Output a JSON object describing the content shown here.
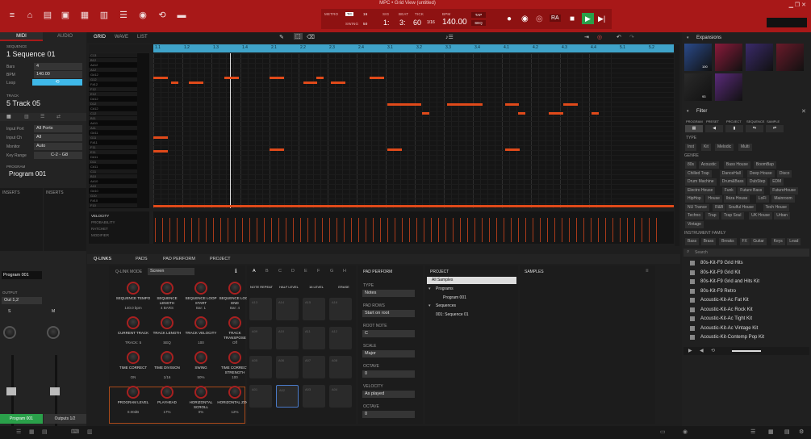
{
  "window": {
    "title": "MPC • Grid View (untitled)"
  },
  "transport": {
    "metro_label": "METRO",
    "tc_label": "TC",
    "tc_value": "16",
    "swing_label": "SWING",
    "swing_value": "50",
    "sig_label": "SIG",
    "beat_label": "BEAT",
    "tick_label": "TICK",
    "bar": "1:",
    "beat": "3:",
    "tick": "60",
    "note_value": "1/16",
    "bpm_label": "BPM",
    "bpm": "140.00",
    "tap": "TAP",
    "seq": "SEQ"
  },
  "left": {
    "tabs": [
      "MIDI",
      "AUDIO"
    ],
    "sequence_label": "SEQUENCE",
    "sequence_name": "1 Sequence 01",
    "bars_label": "Bars",
    "bars_value": "4",
    "bpm_label": "BPM",
    "bpm_value": "140.00",
    "loop_label": "Loop",
    "track_label": "TRACK",
    "track_name": "5 Track 05",
    "input_port_label": "Input Port",
    "input_port": "All Ports",
    "input_ch_label": "Input Ch",
    "input_ch": "All",
    "monitor_label": "Monitor",
    "monitor": "Auto",
    "key_range_label": "Key Range",
    "key_range": "C-2 - G8",
    "program_label": "PROGRAM",
    "program_name": "Program 001",
    "inserts_label": "INSERTS",
    "inserts_label2": "INSERTS",
    "program_field": "Program 001",
    "output_label": "OUTPUT",
    "output": "Out 1,2",
    "s_btn": "S",
    "m_btn": "M",
    "bottom_tab_1": "Program 001",
    "bottom_tab_2": "Outputs 1/2"
  },
  "grid": {
    "tabs": [
      "GRID",
      "WAVE",
      "LIST"
    ],
    "ruler": [
      "1.1",
      "1.2",
      "1.3",
      "1.4",
      "2.1",
      "2.2",
      "2.3",
      "2.4",
      "3.1",
      "3.2",
      "3.3",
      "3.4",
      "4.1",
      "4.2",
      "4.3",
      "4.4",
      "5.1",
      "5.2"
    ],
    "keys": [
      "C13",
      "B12",
      "A#12",
      "A12",
      "G#12",
      "G12",
      "F#12",
      "F12",
      "E12",
      "D#12",
      "D12",
      "C#12",
      "C12",
      "B11",
      "A#11",
      "A11",
      "G#11",
      "G11",
      "F#11",
      "F11",
      "E11",
      "D#11",
      "D11",
      "C#11",
      "C11",
      "B10",
      "A#10",
      "A10",
      "G#10",
      "G10",
      "F#10",
      "F10"
    ],
    "lanes": [
      "VELOCITY",
      "PROBABILITY",
      "RATCHET",
      "MODIFIER"
    ]
  },
  "qlinks": {
    "tabs": [
      "Q-LINKS",
      "PADS",
      "PAD PERFORM",
      "PROJECT"
    ],
    "mode_label": "Q-LINK MODE",
    "mode": "Screen",
    "knobs": [
      {
        "label": "SEQUENCE TEMPO",
        "value": "140.0 bpm"
      },
      {
        "label": "SEQUENCE LENGTH",
        "value": "4 BARS"
      },
      {
        "label": "SEQUENCE LOOP START",
        "value": "Bar: 1"
      },
      {
        "label": "SEQUENCE LOOP END",
        "value": "Bar: 4"
      },
      {
        "label": "CURRENT TRACK",
        "value": "TRACK: 5"
      },
      {
        "label": "TRACK LENGTH",
        "value": "SEQ"
      },
      {
        "label": "TRACK VELOCITY",
        "value": "100"
      },
      {
        "label": "TRACK TRANSPOSE",
        "value": "Off"
      },
      {
        "label": "TIME CORRECT",
        "value": "ON"
      },
      {
        "label": "TIME DIVISION",
        "value": "1/16"
      },
      {
        "label": "SWING",
        "value": "50%"
      },
      {
        "label": "TIME CORRECT STRENGTH",
        "value": "100"
      },
      {
        "label": "PROGRAM LEVEL",
        "value": "0.00dB"
      },
      {
        "label": "PLAYHEAD",
        "value": "17%"
      },
      {
        "label": "HORIZONTAL SCROLL",
        "value": "0%"
      },
      {
        "label": "HORIZONTAL ZOOM",
        "value": "12%"
      }
    ]
  },
  "pads": {
    "banks": [
      "A",
      "B",
      "C",
      "D",
      "E",
      "F",
      "G",
      "H"
    ],
    "buttons": [
      "NOTE REPEAT",
      "HALF LEVEL",
      "16 LEVEL",
      "ERASE"
    ],
    "labels": [
      "A13",
      "A14",
      "A15",
      "A16",
      "A09",
      "A10",
      "A11",
      "A12",
      "A05",
      "A06",
      "A07",
      "A08",
      "A01",
      "A02",
      "A03",
      "A04"
    ]
  },
  "perform": {
    "title": "PAD PERFORM",
    "type_label": "TYPE",
    "type": "Notes",
    "rows_label": "PAD ROWS",
    "rows": "Start on root",
    "root_label": "ROOT NOTE",
    "root": "C",
    "scale_label": "SCALE",
    "scale": "Major",
    "octave_label": "OCTAVE",
    "octave": "0",
    "velocity_label": "VELOCITY",
    "velocity": "As played",
    "octave2_label": "OCTAVE",
    "octave2": "0"
  },
  "project": {
    "title": "PROJECT",
    "all_samples": "All Samples",
    "programs": "Programs",
    "program_item": "Program 001",
    "sequences": "Sequences",
    "sequence_item": "001: Sequence 01",
    "samples_title": "SAMPLES"
  },
  "browser": {
    "expansions": "Expansions",
    "filter": "Filter",
    "filter_tabs": [
      "PROGRAM",
      "PRESET",
      "PROJECT",
      "SEQUENCE",
      "SAMPLE"
    ],
    "type_label": "TYPE",
    "types": [
      "Inst",
      "Kit",
      "Melodic",
      "Multi"
    ],
    "genre_label": "GENRE",
    "genres": [
      "80s",
      "Acoustic",
      "Bass House",
      "BoomBap",
      "Chilled Trap",
      "DanceHall",
      "Deep House",
      "Disco",
      "Drum Machine",
      "Drum&Bass",
      "DubStep",
      "EDM",
      "Electro House",
      "Funk",
      "Future Bass",
      "FutureHouse",
      "HipHop",
      "House",
      "Ibiza House",
      "LoFi",
      "Mainroom",
      "NU Trance",
      "R&B",
      "Soulful House",
      "Tech House",
      "Techno",
      "Trap",
      "Trap Soul",
      "UK House",
      "Urban",
      "Vintage"
    ],
    "instrument_label": "INSTRUMENT FAMILY",
    "instruments": [
      "Bass",
      "Brass",
      "Breaks",
      "FX",
      "Guitar",
      "Keys",
      "Lead"
    ],
    "search_placeholder": "Search",
    "items": [
      "80s-Kit-F9 Grid Hits",
      "80s-Kit-F9 Grid Kit",
      "80s-Kit-F9 Grid and Hits Kit",
      "80s-Kit-F9 Retro",
      "Acoustic-Kit-Ac Fat Kit",
      "Acoustic-Kit-Ac Rock Kit",
      "Acoustic-Kit-Ac Tight Kit",
      "Acoustic-Kit-Ac Vintage Kit",
      "Acoustic-Kit-Contemp Pop Kit"
    ],
    "exp_labels": [
      "100",
      "",
      "",
      "",
      "93",
      ""
    ]
  },
  "colors": {
    "accent": "#a81818",
    "note": "#e04a1a",
    "ruler": "#3fa3c9"
  }
}
